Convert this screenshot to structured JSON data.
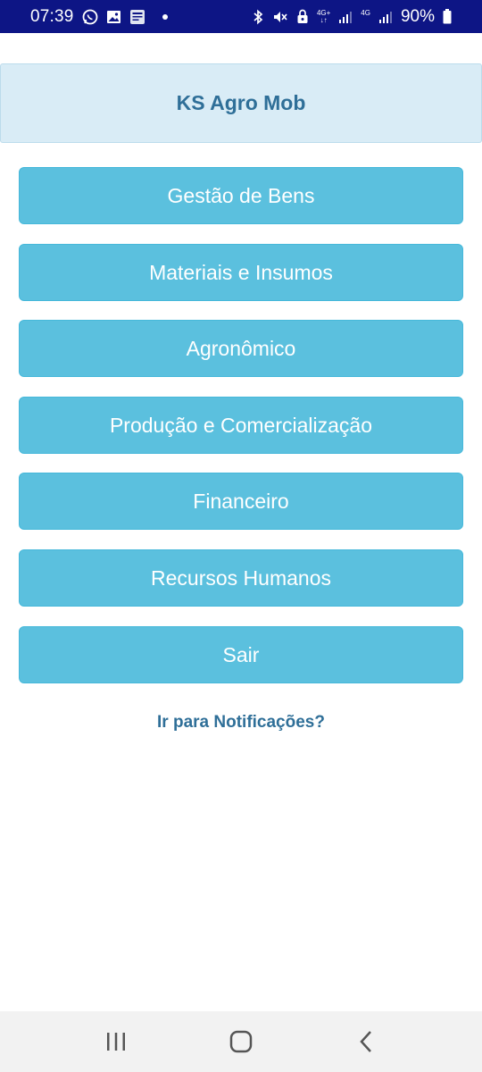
{
  "status_bar": {
    "time": "07:39",
    "network_top": "4G+",
    "network_second": "4G",
    "battery": "90%"
  },
  "header": {
    "title": "KS Agro Mob"
  },
  "menu": {
    "items": [
      {
        "label": "Gestão de Bens"
      },
      {
        "label": "Materiais e Insumos"
      },
      {
        "label": "Agronômico"
      },
      {
        "label": "Produção e Comercialização"
      },
      {
        "label": "Financeiro"
      },
      {
        "label": "Recursos Humanos"
      },
      {
        "label": "Sair"
      }
    ]
  },
  "notifications_link": "Ir para Notificações?",
  "colors": {
    "status_bar": "#0d1585",
    "header_bg": "#d9ecf6",
    "header_text": "#2f6f98",
    "button_bg": "#5bc0de",
    "link": "#2f6f98"
  },
  "nav_bar": {
    "icons": [
      "recent-apps-icon",
      "home-icon",
      "back-icon"
    ]
  }
}
